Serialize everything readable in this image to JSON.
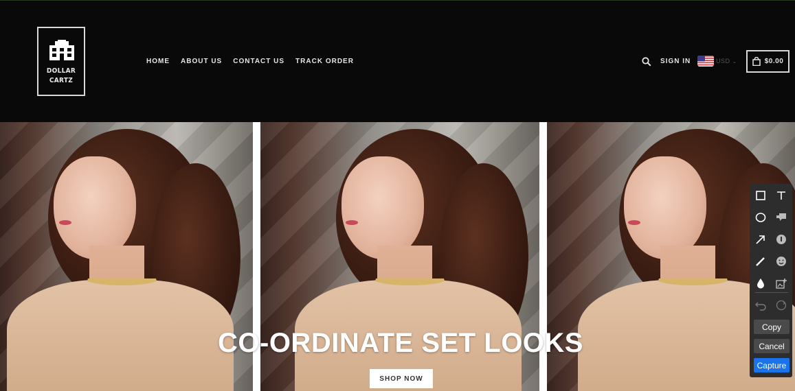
{
  "brand": {
    "name_line1": "DOLLAR",
    "name_line2": "CARTZ",
    "icon": "building-icon"
  },
  "nav": {
    "items": [
      "HOME",
      "ABOUT US",
      "CONTACT US",
      "TRACK ORDER"
    ]
  },
  "header_right": {
    "search_icon": "search-icon",
    "signin_label": "SIGN IN",
    "currency_code": "USD",
    "currency_flag": "us-flag-icon",
    "cart_icon": "shopping-bag-icon",
    "cart_total": "$0.00"
  },
  "hero": {
    "title": "CO-ORDINATE SET LOOKS",
    "cta_label": "SHOP NOW"
  },
  "capture_toolbar": {
    "tools": [
      "rectangle-icon",
      "text-icon",
      "ellipse-icon",
      "callout-icon",
      "arrow-icon",
      "info-badge-icon",
      "pen-icon",
      "emoji-icon",
      "blur-drop-icon",
      "add-image-icon",
      "undo-icon",
      "redo-icon"
    ],
    "copy_label": "Copy",
    "cancel_label": "Cancel",
    "capture_label": "Capture"
  },
  "colors": {
    "header_bg": "#090909",
    "capture_blue": "#1a73e8",
    "toolbar_bg": "#2d2d2d"
  }
}
